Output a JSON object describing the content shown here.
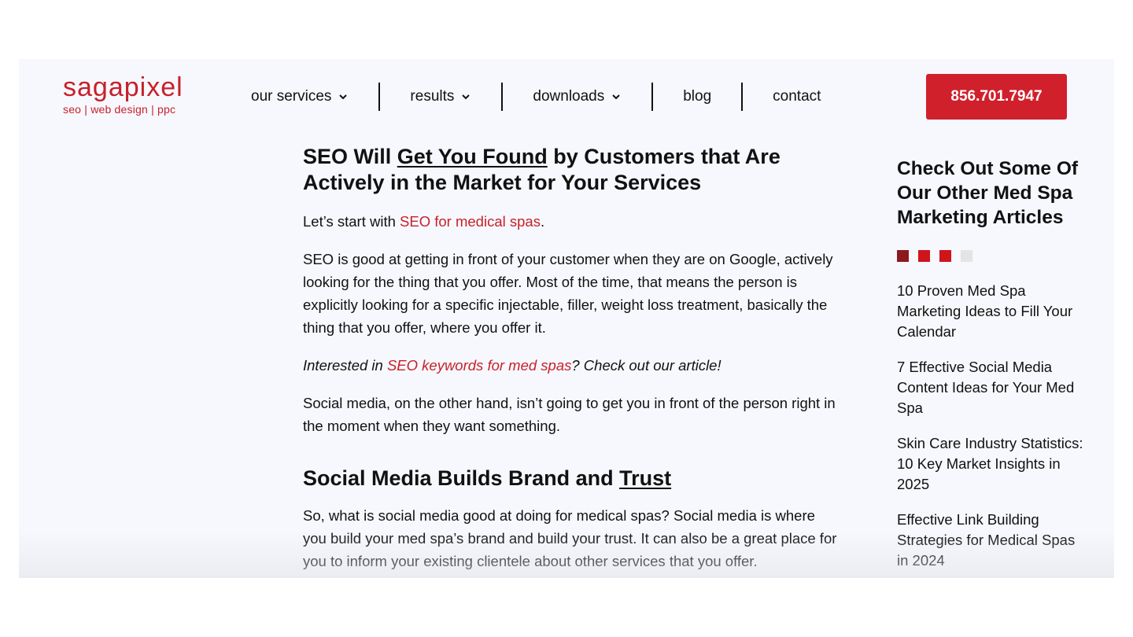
{
  "logo": {
    "name": "sagapixel",
    "tagline": "seo | web design | ppc"
  },
  "nav": {
    "items": [
      {
        "label": "our services",
        "has_dropdown": true
      },
      {
        "label": "results",
        "has_dropdown": true
      },
      {
        "label": "downloads",
        "has_dropdown": true
      },
      {
        "label": "blog",
        "has_dropdown": false
      },
      {
        "label": "contact",
        "has_dropdown": false
      }
    ],
    "phone": "856.701.7947"
  },
  "article": {
    "heading1": {
      "before": "SEO Will ",
      "underlined": "Get You Found",
      "after": " by Customers that Are Actively in the Market for Your Services"
    },
    "p1": {
      "before": "Let’s start with ",
      "link": "SEO for medical spas",
      "after": "."
    },
    "p2": "SEO is good at getting in front of your customer when they are on Google, actively looking for the thing that you offer. Most of the time, that means the person is explicitly looking for a specific injectable, filler, weight loss treatment, basically the thing that you offer, where you offer it.",
    "p3": {
      "before": "Interested in ",
      "link": "SEO keywords for med spas",
      "after": "? Check out our article!"
    },
    "p4": "Social media, on the other hand, isn’t going to get you in front of the person right in the moment when they want something.",
    "heading2": {
      "before": "Social Media Builds Brand and ",
      "underlined": "Trust"
    },
    "p5": "So, what is social media good at doing for medical spas? Social media is where you build your med spa’s brand and build your trust. It can also be a great place for you to inform your existing clientele about other services that you offer."
  },
  "sidebar": {
    "title": "Check Out Some Of Our Other Med Spa Marketing Articles",
    "articles": [
      "10 Proven Med Spa Marketing Ideas to Fill Your Calendar",
      "7 Effective Social Media Content Ideas for Your Med Spa",
      "Skin Care Industry Statistics: 10 Key Market Insights in 2025",
      "Effective Link Building Strategies for Medical Spas in 2024"
    ]
  },
  "colors": {
    "brand_red": "#c8202a",
    "button_red": "#d0202c",
    "dot_active": "#8b1a20",
    "dot_red": "#d0141c",
    "dot_inactive": "#e4e4e4",
    "page_bg": "#f6f8fd"
  },
  "icons": {
    "dropdown": "chevron-down-icon"
  }
}
